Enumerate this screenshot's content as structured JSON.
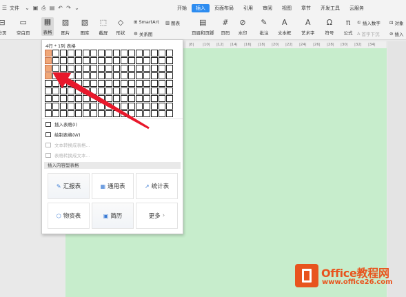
{
  "menubar": {
    "file_label": "文件",
    "menus": [
      "开始",
      "插入",
      "页面布局",
      "引用",
      "审阅",
      "视图",
      "章节",
      "开发工具",
      "云服务"
    ],
    "active_menu": "插入"
  },
  "ribbon": {
    "page_break_label": "分页",
    "blank_page_label": "空白页",
    "table_label": "表格",
    "picture_label": "图片",
    "shapes_pic_label": "图库",
    "screenshot_label": "截屏",
    "shapes_label": "形状",
    "smartart_label": "SmartArt",
    "chart_label": "图表",
    "relation_label": "关系图",
    "header_footer_label": "页眉和页脚",
    "page_number_label": "页码",
    "watermark_label": "水印",
    "comment_label": "批注",
    "textbox_label": "文本框",
    "wordart_label": "艺术字",
    "symbol_label": "符号",
    "formula_label": "公式",
    "insert_number_label": "插入数字",
    "first_drop_label": "首字下沉",
    "object_label": "对象",
    "attach_label": "插入"
  },
  "ruler": {
    "ticks": [
      "|8|",
      "|10|",
      "|12|",
      "|14|",
      "|16|",
      "|18|",
      "|20|",
      "|22|",
      "|24|",
      "|26|",
      "|28|",
      "|30|",
      "|32|",
      "|34|"
    ]
  },
  "dropdown": {
    "title": "4行 * 1列 表格",
    "grid_cols": 17,
    "grid_rows": 9,
    "selected_rows": 4,
    "selected_cols": 1,
    "items": [
      {
        "label": "插入表格(I)",
        "disabled": false
      },
      {
        "label": "绘制表格(W)",
        "disabled": false
      },
      {
        "label": "文本转换成表格...",
        "disabled": true
      },
      {
        "label": "表格转换成文本...",
        "disabled": true
      }
    ],
    "section_title": "插入内容型表格",
    "templates": [
      {
        "label": "汇报表",
        "icon": "✎"
      },
      {
        "label": "通用表",
        "icon": "▦"
      },
      {
        "label": "统计表",
        "icon": "📈"
      },
      {
        "label": "物资表",
        "icon": "⬡"
      },
      {
        "label": "简历",
        "icon": "▣"
      },
      {
        "label": "更多",
        "icon": "›"
      }
    ]
  },
  "watermark": {
    "brand": "Office教程网",
    "url": "www.office26.com"
  },
  "colors": {
    "page_bg": "#c7edcc",
    "accent": "#2d8cf0",
    "selected_cell": "#f0a778",
    "arrow": "#e8182b",
    "brand": "#e8541e"
  }
}
